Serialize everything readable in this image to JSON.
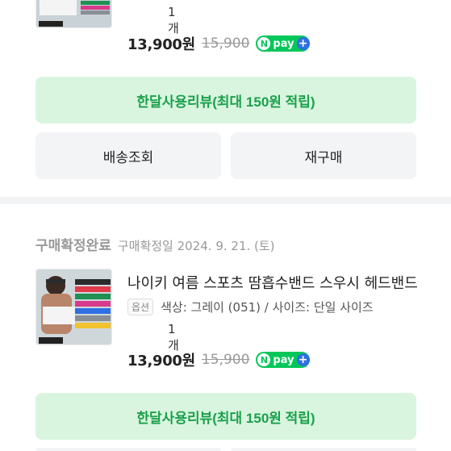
{
  "orders": [
    {
      "quantity": "1개",
      "price": "13,900원",
      "original_price": "15,900",
      "npay": {
        "n": "N",
        "label": "pay",
        "plus": "+"
      },
      "review_button": "한달사용리뷰(최대 150원 적립)",
      "delivery_button": "배송조회",
      "rebuy_button": "재구매"
    },
    {
      "status": "구매확정완료",
      "status_date": "구매확정일 2024. 9. 21. (토)",
      "title": "나이키 여름 스포츠 땀흡수밴드 스우시 헤드밴드",
      "option_badge": "옵션",
      "option_text": "색상: 그레이 (051) / 사이즈: 단일 사이즈",
      "quantity": "1개",
      "price": "13,900원",
      "original_price": "15,900",
      "npay": {
        "n": "N",
        "label": "pay",
        "plus": "+"
      },
      "review_button": "한달사용리뷰(최대 150원 적립)"
    }
  ],
  "colors": {
    "accent_green": "#03c75a",
    "review_text": "#1aa04a",
    "review_bg": "#d9f5df"
  },
  "icons": [
    "product-thumbnail-image",
    "npay-logo-icon",
    "plus-icon"
  ]
}
